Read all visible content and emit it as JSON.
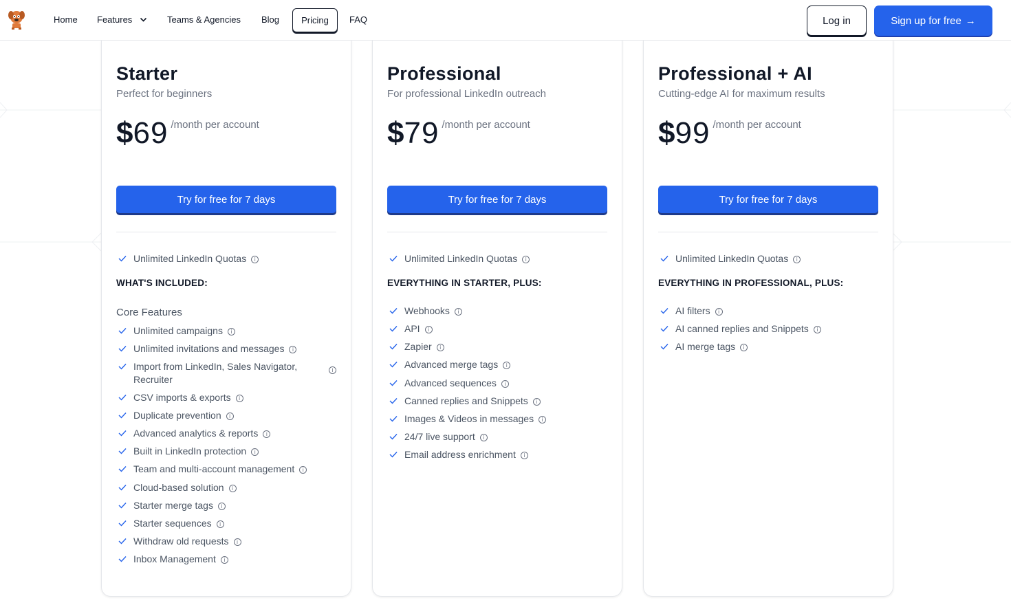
{
  "nav": {
    "home": "Home",
    "features": "Features",
    "teams": "Teams & Agencies",
    "blog": "Blog",
    "pricing": "Pricing",
    "faq": "FAQ",
    "login": "Log in",
    "signup": "Sign up for free"
  },
  "colors": {
    "accent": "#2563eb",
    "text": "#111827",
    "muted": "#6b7280"
  },
  "plans": [
    {
      "name": "Starter",
      "subtitle": "Perfect for beginners",
      "currency": "$",
      "price": "69",
      "period": "/month per account",
      "cta": "Try for free for 7 days",
      "quota": "Unlimited LinkedIn Quotas",
      "section": "WHAT'S INCLUDED:",
      "group": "Core Features",
      "features": [
        "Unlimited campaigns",
        "Unlimited invitations and messages",
        "Import from LinkedIn, Sales Navigator, Recruiter",
        "CSV imports & exports",
        "Duplicate prevention",
        "Advanced analytics & reports",
        "Built in LinkedIn protection",
        "Team and multi-account management",
        "Cloud-based solution",
        "Starter merge tags",
        "Starter sequences",
        "Withdraw old requests",
        "Inbox Management"
      ]
    },
    {
      "name": "Professional",
      "subtitle": "For professional LinkedIn outreach",
      "currency": "$",
      "price": "79",
      "period": "/month per account",
      "cta": "Try for free for 7 days",
      "quota": "Unlimited LinkedIn Quotas",
      "section": "EVERYTHING IN STARTER, PLUS:",
      "features": [
        "Webhooks",
        "API",
        "Zapier",
        "Advanced merge tags",
        "Advanced sequences",
        "Canned replies and Snippets",
        "Images & Videos in messages",
        "24/7 live support",
        "Email address enrichment"
      ]
    },
    {
      "name": "Professional + AI",
      "subtitle": "Cutting-edge AI for maximum results",
      "currency": "$",
      "price": "99",
      "period": "/month per account",
      "cta": "Try for free for 7 days",
      "quota": "Unlimited LinkedIn Quotas",
      "section": "EVERYTHING IN PROFESSIONAL, PLUS:",
      "features": [
        "AI filters",
        "AI canned replies and Snippets",
        "AI merge tags"
      ]
    }
  ]
}
